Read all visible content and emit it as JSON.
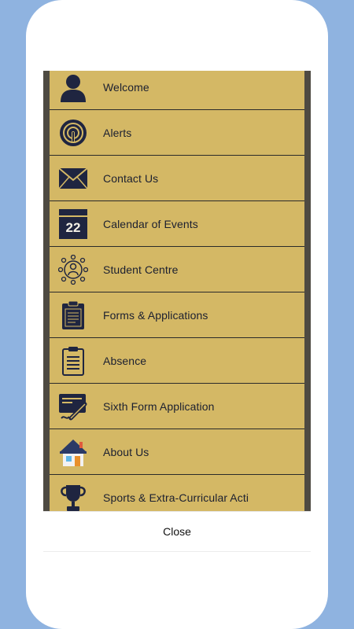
{
  "menu": {
    "items": [
      {
        "label": "Welcome",
        "icon": "person-icon"
      },
      {
        "label": "Alerts",
        "icon": "alert-signal-icon"
      },
      {
        "label": "Contact Us",
        "icon": "envelope-icon"
      },
      {
        "label": "Calendar of Events",
        "icon": "calendar-icon",
        "icon_text": "22"
      },
      {
        "label": "Student Centre",
        "icon": "network-person-icon"
      },
      {
        "label": "Forms & Applications",
        "icon": "clipboard-icon"
      },
      {
        "label": "Absence",
        "icon": "checklist-icon"
      },
      {
        "label": "Sixth Form Application",
        "icon": "signature-form-icon"
      },
      {
        "label": "About Us",
        "icon": "house-icon"
      },
      {
        "label": "Sports & Extra-Curricular Acti",
        "icon": "trophy-icon"
      }
    ]
  },
  "footer": {
    "close_label": "Close"
  },
  "colors": {
    "background": "#8fb3e0",
    "menu_item": "#d4b865",
    "icon_navy": "#1f2540",
    "text": "#1b1f30"
  }
}
